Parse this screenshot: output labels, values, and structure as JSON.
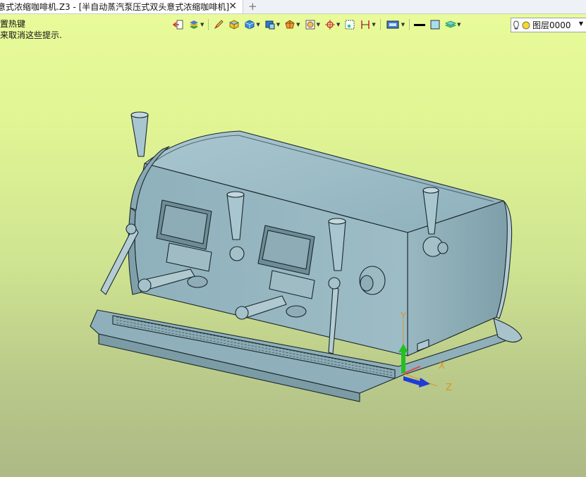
{
  "tab": {
    "title": "意式浓缩咖啡机.Z3 - [半自动蒸汽泵压式双头意式浓缩咖啡机]",
    "close": "✕",
    "new": "+"
  },
  "hints": {
    "line1": "置热键",
    "line2": "来取消这些提示."
  },
  "toolbar": {
    "layer_label": "图层0000"
  },
  "axes": {
    "y": "Y",
    "x": "X",
    "z": "Z"
  },
  "colors": {
    "background_top": "#e9fb9a",
    "background_bottom": "#adb986",
    "model": "#98b8c2",
    "axis_y": "#22c022",
    "axis_z": "#1f3bd8",
    "axis_labels": "#d89628"
  }
}
